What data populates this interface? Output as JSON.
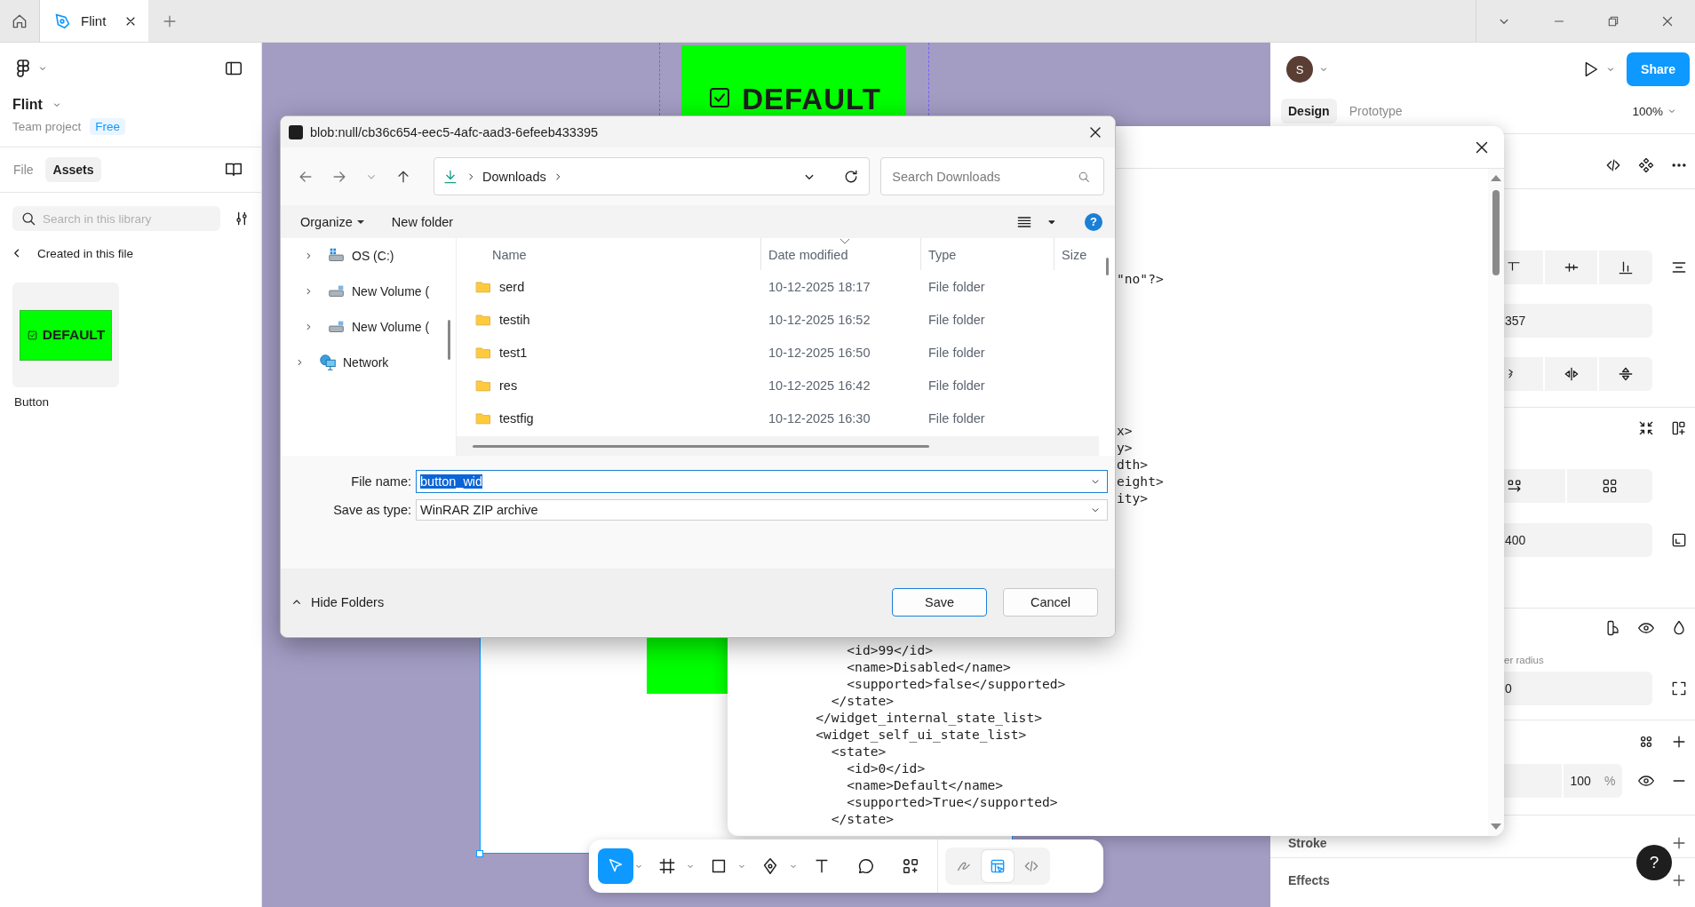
{
  "browser_tabs": [
    {
      "label": "Flint",
      "selected": true
    }
  ],
  "left_panel": {
    "file_name": "Flint",
    "project": "Team project",
    "plan_badge": "Free",
    "tabs": [
      {
        "label": "File",
        "selected": false
      },
      {
        "label": "Assets",
        "selected": true
      }
    ],
    "search": {
      "placeholder": "Search in this library"
    },
    "breadcrumb": "Created in this file",
    "assets": [
      {
        "label": "Button",
        "preview_text": "DEFAULT"
      }
    ]
  },
  "canvas": {
    "frame_text": "DEFAULT"
  },
  "right_panel": {
    "avatar": "S",
    "share": "Share",
    "tabs": [
      {
        "label": "Design",
        "selected": true
      },
      {
        "label": "Prototype",
        "selected": false
      }
    ],
    "zoom": "100%",
    "position_value": "357",
    "size_value": "400",
    "corner_label": "er radius",
    "corner_value": "0",
    "opacity": "100",
    "opacity_unit": "%",
    "sections": [
      "Stroke",
      "Effects"
    ]
  },
  "help": "?",
  "code_panel": {
    "fragments_top": [
      "\"no\"?>"
    ],
    "fragments_mid": [
      "x>",
      "y>",
      "dth>",
      "eight>",
      "ity>"
    ],
    "lines": [
      "        <id>99</id>",
      "        <name>Disabled</name>",
      "        <supported>false</supported>",
      "      </state>",
      "    </widget_internal_state_list>",
      "    <widget_self_ui_state_list>",
      "      <state>",
      "        <id>0</id>",
      "        <name>Default</name>",
      "        <supported>True</supported>",
      "      </state>"
    ]
  },
  "save_dialog": {
    "title": "blob:null/cb36c654-eec5-4afc-aad3-6efeeb433395",
    "location": "Downloads",
    "search": {
      "placeholder": "Search Downloads"
    },
    "toolbar": {
      "organize": "Organize",
      "new_folder": "New folder",
      "help": "?"
    },
    "tree": [
      {
        "label": "OS (C:)",
        "kind": "system-drive",
        "expanded": false
      },
      {
        "label": "New Volume (",
        "kind": "drive",
        "expanded": false
      },
      {
        "label": "New Volume (",
        "kind": "drive",
        "expanded": false
      },
      {
        "label": "Network",
        "kind": "network",
        "expanded": false
      }
    ],
    "columns": [
      {
        "label": "Name",
        "sorted": false
      },
      {
        "label": "Date modified",
        "sorted": true
      },
      {
        "label": "Type",
        "sorted": false
      },
      {
        "label": "Size",
        "sorted": false
      }
    ],
    "files": [
      {
        "name": "serd",
        "date": "10-12-2025 18:17",
        "type": "File folder"
      },
      {
        "name": "testih",
        "date": "10-12-2025 16:52",
        "type": "File folder"
      },
      {
        "name": "test1",
        "date": "10-12-2025 16:50",
        "type": "File folder"
      },
      {
        "name": "res",
        "date": "10-12-2025 16:42",
        "type": "File folder"
      },
      {
        "name": "testfig",
        "date": "10-12-2025 16:30",
        "type": "File folder"
      }
    ],
    "file_name_label": "File name:",
    "file_name": {
      "value": "button_wid",
      "highlighted": true
    },
    "type_label": "Save as type:",
    "type_value": "WinRAR ZIP archive",
    "hide_folders": "Hide Folders",
    "buttons": [
      "Save",
      "Cancel"
    ]
  },
  "toolbar": {
    "tools": [
      {
        "kind": "move",
        "selected": true,
        "menu": true
      },
      {
        "kind": "frame",
        "selected": false,
        "menu": true
      },
      {
        "kind": "shape",
        "selected": false,
        "menu": true
      },
      {
        "kind": "pen",
        "selected": false,
        "menu": true
      },
      {
        "kind": "text",
        "selected": false,
        "menu": false
      },
      {
        "kind": "comment",
        "selected": false,
        "menu": false
      },
      {
        "kind": "assets",
        "selected": false,
        "menu": false
      }
    ],
    "modes": [
      {
        "kind": "draw",
        "selected": false
      },
      {
        "kind": "dev",
        "selected": true
      },
      {
        "kind": "code",
        "selected": false
      }
    ]
  }
}
